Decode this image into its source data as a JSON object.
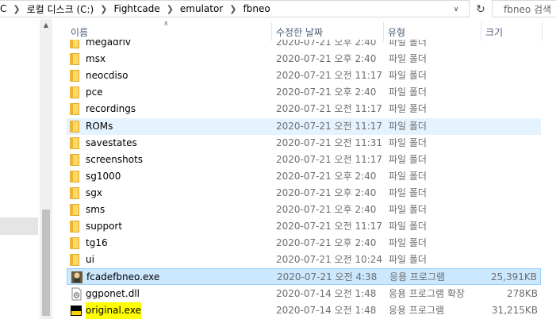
{
  "address_bar": {
    "parts": [
      "C",
      "로컬 디스크 (C:)",
      "Fightcade",
      "emulator",
      "fbneo"
    ],
    "refresh_icon": "refresh-icon",
    "dropdown_icon": "chevron-down-icon"
  },
  "search": {
    "placeholder": "fbneo 검색"
  },
  "columns": {
    "name": "이름",
    "date": "수정한 날짜",
    "type": "유형",
    "size": "크기"
  },
  "files": [
    {
      "name": "megadriv",
      "date": "2020-07-21 오후 2:40",
      "type": "파일 폴더",
      "size": "",
      "icon": "folder-icon"
    },
    {
      "name": "msx",
      "date": "2020-07-21 오후 2:40",
      "type": "파일 폴더",
      "size": "",
      "icon": "folder-icon"
    },
    {
      "name": "neocdiso",
      "date": "2020-07-21 오전 11:17",
      "type": "파일 폴더",
      "size": "",
      "icon": "folder-icon"
    },
    {
      "name": "pce",
      "date": "2020-07-21 오후 2:40",
      "type": "파일 폴더",
      "size": "",
      "icon": "folder-icon"
    },
    {
      "name": "recordings",
      "date": "2020-07-21 오전 11:17",
      "type": "파일 폴더",
      "size": "",
      "icon": "folder-icon"
    },
    {
      "name": "ROMs",
      "date": "2020-07-21 오전 11:17",
      "type": "파일 폴더",
      "size": "",
      "icon": "folder-icon",
      "state": "hover"
    },
    {
      "name": "savestates",
      "date": "2020-07-21 오전 11:31",
      "type": "파일 폴더",
      "size": "",
      "icon": "folder-icon"
    },
    {
      "name": "screenshots",
      "date": "2020-07-21 오전 11:17",
      "type": "파일 폴더",
      "size": "",
      "icon": "folder-icon"
    },
    {
      "name": "sg1000",
      "date": "2020-07-21 오후 2:40",
      "type": "파일 폴더",
      "size": "",
      "icon": "folder-icon"
    },
    {
      "name": "sgx",
      "date": "2020-07-21 오후 2:40",
      "type": "파일 폴더",
      "size": "",
      "icon": "folder-icon"
    },
    {
      "name": "sms",
      "date": "2020-07-21 오후 2:40",
      "type": "파일 폴더",
      "size": "",
      "icon": "folder-icon"
    },
    {
      "name": "support",
      "date": "2020-07-21 오전 11:17",
      "type": "파일 폴더",
      "size": "",
      "icon": "folder-icon"
    },
    {
      "name": "tg16",
      "date": "2020-07-21 오후 2:40",
      "type": "파일 폴더",
      "size": "",
      "icon": "folder-icon"
    },
    {
      "name": "ui",
      "date": "2020-07-21 오전 10:24",
      "type": "파일 폴더",
      "size": "",
      "icon": "folder-icon"
    },
    {
      "name": "fcadefbneo.exe",
      "date": "2020-07-21 오전 4:38",
      "type": "응용 프로그램",
      "size": "25,391KB",
      "icon": "fbneo-app-icon",
      "state": "selected"
    },
    {
      "name": "ggponet.dll",
      "date": "2020-07-14 오전 1:48",
      "type": "응용 프로그램 확장",
      "size": "278KB",
      "icon": "dll-file-icon"
    },
    {
      "name": "original.exe",
      "date": "2020-07-14 오전 1:48",
      "type": "응용 프로그램",
      "size": "31,215KB",
      "icon": "exe-file-icon",
      "highlight": "#ffff00"
    }
  ],
  "colors": {
    "hover_row": "#e5f3ff",
    "selected_row": "#cce8ff",
    "selected_border": "#99d1ff",
    "header_text": "#4c607a",
    "folder": "#ffd862"
  }
}
